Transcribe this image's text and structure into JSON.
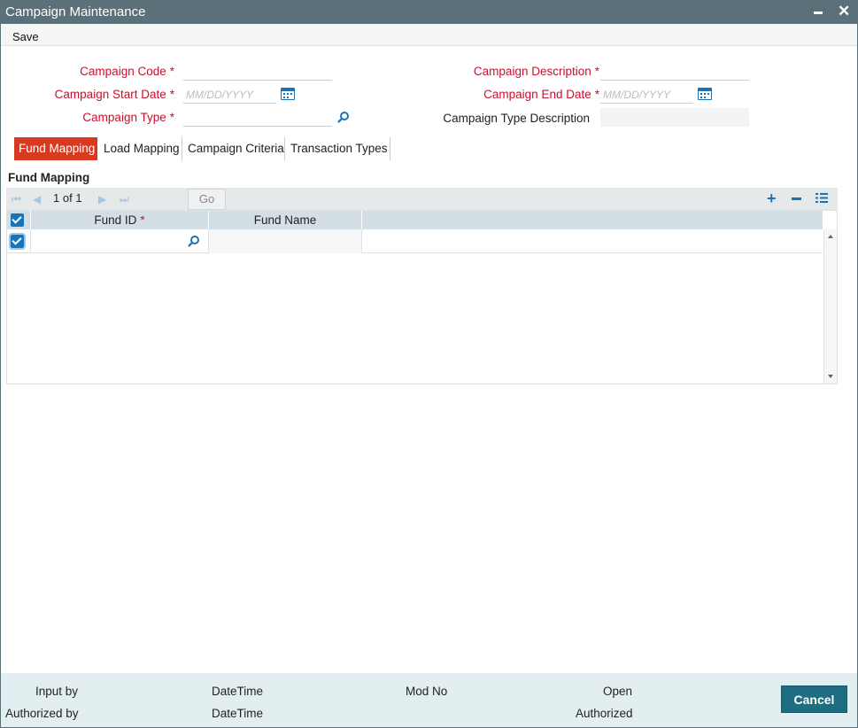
{
  "window": {
    "title": "Campaign Maintenance"
  },
  "menu": {
    "save_label": "Save"
  },
  "form": {
    "required_marker": "*",
    "campaign_code": {
      "label": "Campaign Code",
      "value": ""
    },
    "campaign_description": {
      "label": "Campaign Description",
      "value": ""
    },
    "campaign_start_date": {
      "label": "Campaign Start Date",
      "placeholder": "MM/DD/YYYY",
      "value": ""
    },
    "campaign_end_date": {
      "label": "Campaign End Date",
      "placeholder": "MM/DD/YYYY",
      "value": ""
    },
    "campaign_type": {
      "label": "Campaign Type",
      "value": ""
    },
    "campaign_type_description": {
      "label": "Campaign Type Description",
      "value": ""
    }
  },
  "tabs": [
    {
      "label": "Fund Mapping",
      "active": true
    },
    {
      "label": "Load Mapping",
      "active": false
    },
    {
      "label": "Campaign Criteria",
      "active": false
    },
    {
      "label": "Transaction Types",
      "active": false
    }
  ],
  "section": {
    "title": "Fund Mapping"
  },
  "pager": {
    "current": "1",
    "of_label": "of",
    "total": "1",
    "go_label": "Go"
  },
  "grid": {
    "columns": [
      {
        "label": "Fund ID",
        "required": true
      },
      {
        "label": "Fund Name",
        "required": false
      }
    ],
    "rows": [
      {
        "selected": true,
        "fund_id": "",
        "fund_name": ""
      }
    ]
  },
  "footer": {
    "input_by_label": "Input by",
    "authorized_by_label": "Authorized by",
    "datetime_label_1": "DateTime",
    "datetime_label_2": "DateTime",
    "mod_no_label": "Mod No",
    "open_label": "Open",
    "authorized_label": "Authorized",
    "cancel_label": "Cancel"
  },
  "colors": {
    "titlebar": "#5b7079",
    "required_label": "#c8102e",
    "active_tab": "#d9391f",
    "icon_blue": "#1a73b5",
    "footer_bg": "#e3eef1",
    "cancel_button": "#1c6e80"
  }
}
